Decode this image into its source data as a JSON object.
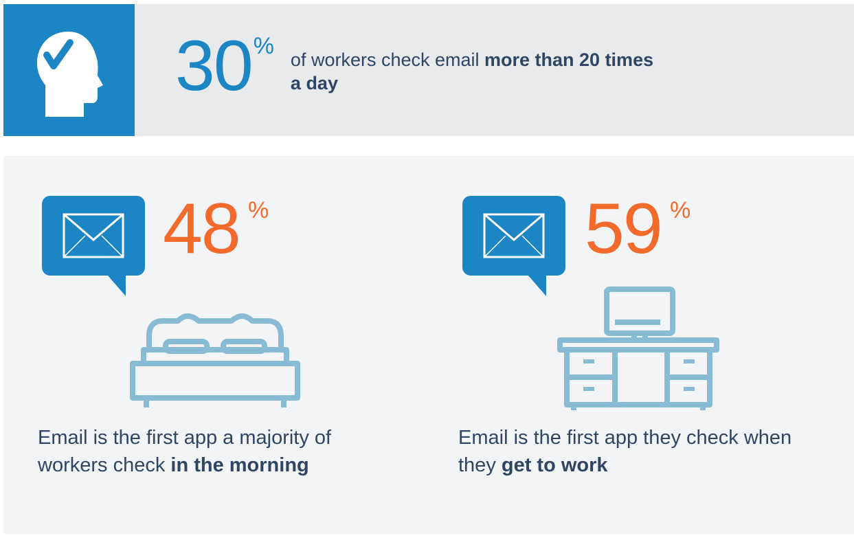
{
  "top": {
    "value": "30",
    "unit": "%",
    "text_before": "of workers check email ",
    "text_bold": "more than 20 times a day"
  },
  "left_stat": {
    "value": "48",
    "unit": "%",
    "caption_before": "Email is the first app a majority of workers check ",
    "caption_bold": "in the morning"
  },
  "right_stat": {
    "value": "59",
    "unit": "%",
    "caption_before": "Email is the first app they check when they ",
    "caption_bold": "get to work"
  },
  "colors": {
    "blue": "#1c85c4",
    "orange": "#f26b2d",
    "text": "#2f4563",
    "icon_light": "#89bcd4"
  },
  "icons": [
    "head-checkmark-icon",
    "email-bubble-icon",
    "bed-icon",
    "desk-computer-icon"
  ]
}
